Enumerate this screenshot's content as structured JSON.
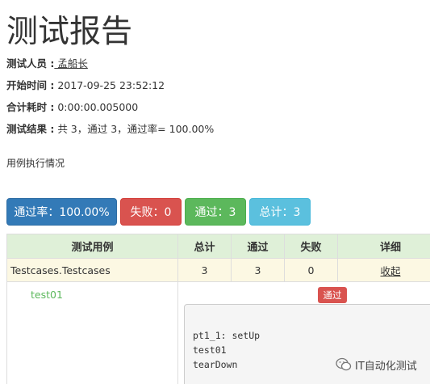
{
  "report": {
    "title": "测试报告",
    "attributes": [
      {
        "key": "测试人员 :",
        "value": " 孟船长"
      },
      {
        "key": "开始时间 :",
        "value": " 2017-09-25 23:52:12"
      },
      {
        "key": "合计耗时 :",
        "value": " 0:00:00.005000"
      },
      {
        "key": "测试结果 :",
        "value": " 共 3，通过 3，通过率= 100.00%"
      }
    ],
    "section_note": "用例执行情况"
  },
  "summary_buttons": {
    "pass_rate": "通过率：100.00%",
    "fail": "失败：0",
    "pass": "通过：3",
    "total": "总计：3"
  },
  "table": {
    "headers": [
      "测试用例",
      "总计",
      "通过",
      "失败",
      "详细"
    ],
    "class_row": {
      "name": "Testcases.Testcases",
      "total": "3",
      "pass": "3",
      "fail": "0",
      "detail_link": "收起"
    },
    "case_row": {
      "name": "test01",
      "status_badge": "通过",
      "log": "pt1_1: setUp\ntest01\ntearDown"
    }
  },
  "watermark": {
    "text": "IT自动化测试"
  },
  "colors": {
    "primary": "#337ab7",
    "danger": "#d9534f",
    "success": "#5cb85c",
    "info": "#5bc0de",
    "header_row": "#dff0d8",
    "class_row": "#fcf8e3"
  }
}
